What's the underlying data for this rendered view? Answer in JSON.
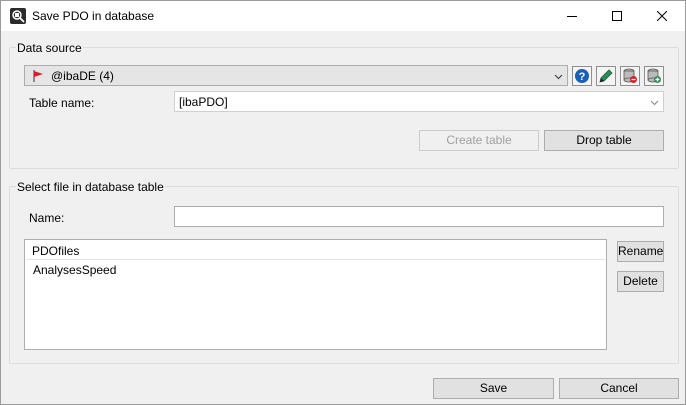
{
  "window": {
    "title": "Save PDO in database"
  },
  "data_source": {
    "group_label": "Data source",
    "selected": "@ibaDE (4)",
    "table_name_label": "Table name:",
    "table_name_value": "[ibaPDO]",
    "create_table_label": "Create table",
    "drop_table_label": "Drop table"
  },
  "select_file": {
    "group_label": "Select file in database table",
    "name_label": "Name:",
    "name_value": "",
    "list_header": "PDOfiles",
    "items": [
      "AnalysesSpeed"
    ],
    "rename_label": "Rename",
    "delete_label": "Delete"
  },
  "footer": {
    "save_label": "Save",
    "cancel_label": "Cancel"
  },
  "colors": {
    "accent_help": "#1a5fb4",
    "pencil": "#2e8b57",
    "db_red": "#d0202a",
    "db_green": "#2e8b57"
  }
}
